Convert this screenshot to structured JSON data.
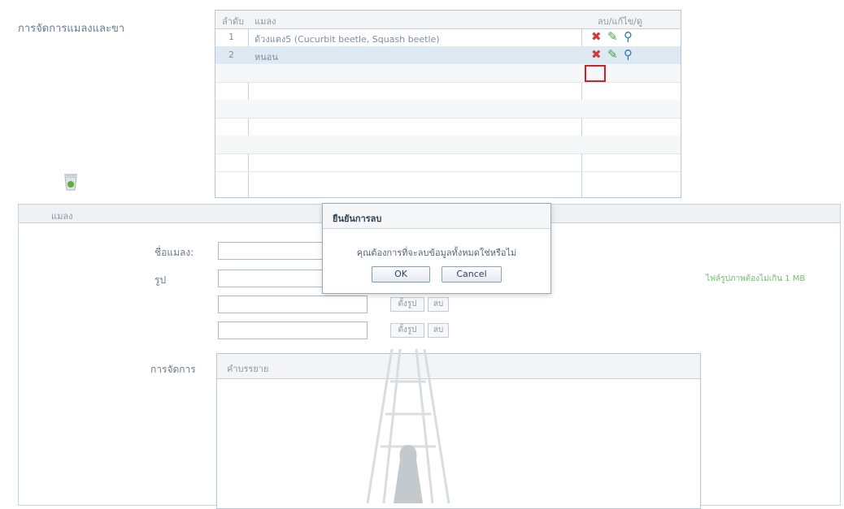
{
  "page": {
    "title": "การจัดการแมลงและขา"
  },
  "table": {
    "headers": {
      "no": "ลำดับ",
      "name": "แมลง",
      "actions": "ลบ/แก้ไข/ดู"
    },
    "rows": [
      {
        "no": "1",
        "name": "ด้วงแตง5 (Cucurbit beetle, Squash beetle)"
      },
      {
        "no": "2",
        "name": "หนอน"
      }
    ]
  },
  "icons": {
    "delete": "delete-icon",
    "edit": "edit-pencil-icon",
    "view": "magnifier-icon",
    "trash": "recycle-bin-icon"
  },
  "form": {
    "panel_title": "แมลง",
    "name_label": "ชื่อแมลง:",
    "image_label": "รูป",
    "manage_label": "การจัดการ",
    "browse_label": "ตั้งรูป",
    "remove_label": "ลบ",
    "hint": "ไฟล์รูปภาพต้องไม่เกิน 1 MB",
    "editor_label": "คำบรรยาย"
  },
  "dialog": {
    "title": "ยืนยันการลบ",
    "message": "คุณต้องการที่จะลบข้อมูลทั้งหมดใช่หรือไม่",
    "ok": "OK",
    "cancel": "Cancel"
  },
  "colors": {
    "delete": "#d23a3a",
    "edit": "#4aa34a",
    "view": "#2d7aa8",
    "highlight": "#d81e1e"
  }
}
